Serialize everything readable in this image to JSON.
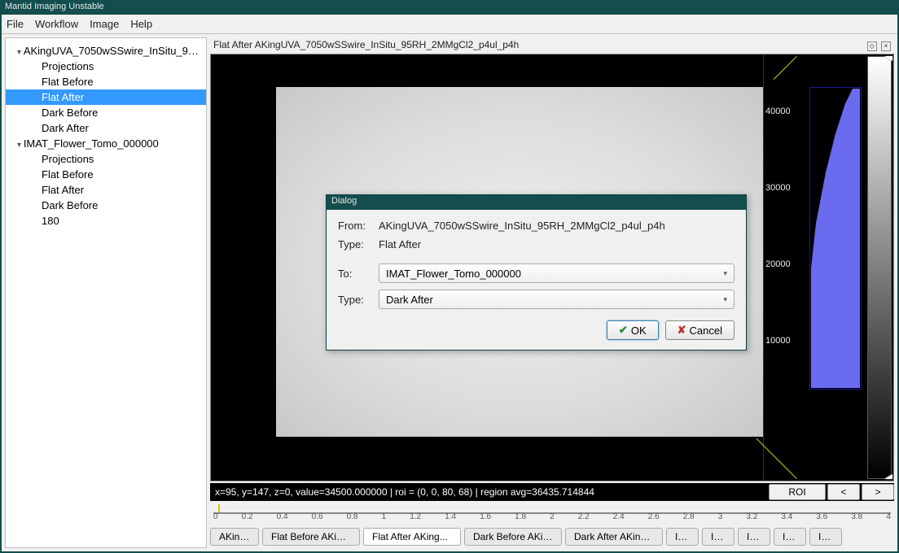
{
  "app_title": "Mantid Imaging Unstable",
  "menubar": [
    "File",
    "Workflow",
    "Image",
    "Help"
  ],
  "tree": {
    "datasets": [
      {
        "name": "AKingUVA_7050wSSwire_InSitu_95RH...",
        "children": [
          "Projections",
          "Flat Before",
          "Flat After",
          "Dark Before",
          "Dark After"
        ],
        "selected": "Flat After"
      },
      {
        "name": "IMAT_Flower_Tomo_000000",
        "children": [
          "Projections",
          "Flat Before",
          "Flat After",
          "Dark Before",
          "180"
        ]
      }
    ]
  },
  "main_title": "Flat After AKingUVA_7050wSSwire_InSitu_95RH_2MMgCl2_p4ul_p4h",
  "histogram_ticks": [
    "40000",
    "30000",
    "20000",
    "10000"
  ],
  "status_text": "x=95, y=147, z=0, value=34500.000000 | roi = (0, 0, 80, 68) | region avg=36435.714844",
  "status_buttons": {
    "roi": "ROI",
    "prev": "<",
    "next": ">"
  },
  "slider_ticks": [
    "0",
    "0.2",
    "0.4",
    "0.6",
    "0.8",
    "1",
    "1.2",
    "1.4",
    "1.6",
    "1.8",
    "2",
    "2.2",
    "2.4",
    "2.6",
    "2.8",
    "3",
    "3.2",
    "3.4",
    "3.6",
    "3.8",
    "4"
  ],
  "tabs": [
    "AKing...",
    "Flat Before AKing...",
    "Flat After AKing...",
    "Dark Before AKing...",
    "Dark After AKing...",
    "IM...",
    "IM...",
    "IM...",
    "IM...",
    "IM..."
  ],
  "active_tab_index": 2,
  "dialog": {
    "title": "Dialog",
    "from_label": "From:",
    "from_value": "AKingUVA_7050wSSwire_InSitu_95RH_2MMgCl2_p4ul_p4h",
    "type1_label": "Type:",
    "type1_value": "Flat After",
    "to_label": "To:",
    "to_value": "IMAT_Flower_Tomo_000000",
    "type2_label": "Type:",
    "type2_value": "Dark After",
    "ok": "OK",
    "cancel": "Cancel"
  }
}
